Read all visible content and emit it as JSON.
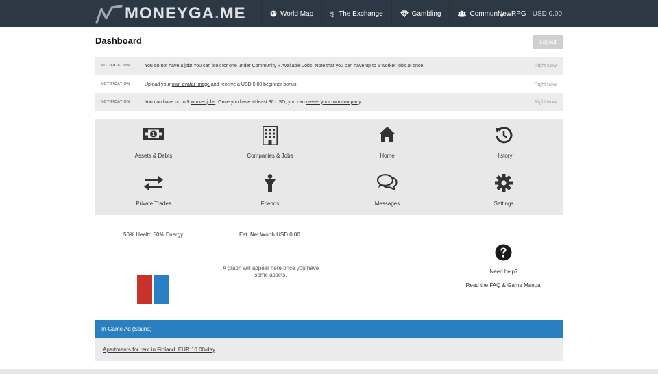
{
  "header": {
    "logo_text": "MONEYGA",
    "logo_dot": ".",
    "logo_suffix": "ME",
    "nav": [
      {
        "label": "World Map",
        "icon": "globe-icon"
      },
      {
        "label": "The Exchange",
        "icon": "dollar-icon"
      },
      {
        "label": "Gambling",
        "icon": "diamond-icon"
      },
      {
        "label": "Community",
        "icon": "community-icon"
      }
    ],
    "username": "NewRPG",
    "balance": "USD 0.00"
  },
  "page": {
    "title": "Dashboard",
    "logout_label": "Logout"
  },
  "notifications": [
    {
      "tag": "NOTIFICATION",
      "pre": "You do not have a job! You can look for one under ",
      "link": "Community » Available Jobs",
      "post": ". Note that you can have up to 5 worker jobs at once.",
      "time": "Right Now"
    },
    {
      "tag": "NOTIFICATION",
      "pre": "Upload your ",
      "link": "own avatar image",
      "post": " and receive a USD 5.00 beginner bonus!",
      "time": "Right Now"
    },
    {
      "tag": "NOTIFICATION",
      "pre": "You can have up to 5 ",
      "link": "worker jobs",
      "mid": ". Once you have at least 30 USD, you can ",
      "link2": "create your own company",
      "post": ".",
      "time": "Right Now"
    }
  ],
  "tiles": [
    {
      "label": "Assets & Debts",
      "icon": "money-icon"
    },
    {
      "label": "Companies & Jobs",
      "icon": "building-icon"
    },
    {
      "label": "Home",
      "icon": "home-icon"
    },
    {
      "label": "History",
      "icon": "history-icon"
    },
    {
      "label": "Private Trades",
      "icon": "exchange-icon"
    },
    {
      "label": "Friends",
      "icon": "person-icon"
    },
    {
      "label": "Messages",
      "icon": "chat-icon"
    },
    {
      "label": "Settings",
      "icon": "gear-icon"
    }
  ],
  "stats": {
    "health_energy": "50% Health 50% Energy",
    "health_pct": 50,
    "energy_pct": 50,
    "net_worth": "Est. Net Worth USD 0.00",
    "graph_note": "A graph will appear here once you have some assets."
  },
  "help": {
    "title": "Need help?",
    "link": "Read the FAQ & Game Manual"
  },
  "ad": {
    "heading": "In-Game Ad (Sauna)",
    "text": "Apartments for rent in Finland. EUR 10.00/day"
  },
  "colors": {
    "header_bg": "#2d3845",
    "accent_blue": "#2a7fc1",
    "health_red": "#c9312b",
    "energy_blue": "#2b7fc5",
    "tile_bg": "#e8e8e8"
  }
}
